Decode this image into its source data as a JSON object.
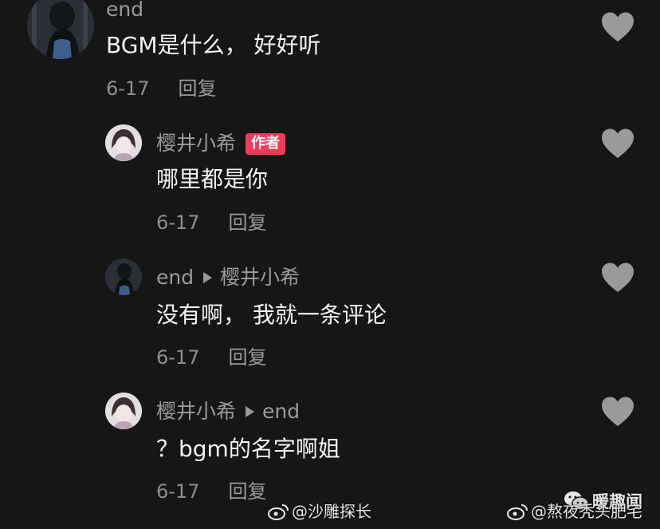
{
  "comments": [
    {
      "username": "end",
      "text": "BGM是什么， 好好听",
      "date": "6-17",
      "reply_label": "回复",
      "avatar_icon": "avatar-dark-girl",
      "like_icon": "heart-icon"
    },
    {
      "username": "樱井小希",
      "badge": "作者",
      "text": "哪里都是你",
      "date": "6-17",
      "reply_label": "回复",
      "avatar_icon": "avatar-light-girl",
      "like_icon": "heart-icon"
    },
    {
      "username": "end",
      "reply_to": "樱井小希",
      "text": "没有啊， 我就一条评论",
      "date": "6-17",
      "reply_label": "回复",
      "avatar_icon": "avatar-dark-girl",
      "like_icon": "heart-icon"
    },
    {
      "username": "樱井小希",
      "reply_to": "end",
      "text": "？bgm的名字啊姐",
      "date": "6-17",
      "reply_label": "回复",
      "avatar_icon": "avatar-light-girl",
      "like_icon": "heart-icon"
    }
  ],
  "watermarks": {
    "weibo_left": "@沙雕探长",
    "wechat": "暖趣闻",
    "weibo_right": "@熬夜秃头肥宅"
  },
  "colors": {
    "background": "#161616",
    "author_badge": "#ee3b5a",
    "heart": "#9a9a9a"
  }
}
